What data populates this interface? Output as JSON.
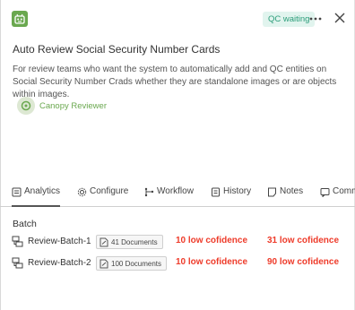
{
  "header": {
    "logo_icon": "robot-icon",
    "status": "QC waiting",
    "more_icon": "more-horizontal-icon",
    "close_icon": "close-icon"
  },
  "project": {
    "title": "Auto Review Social Security Number Cards",
    "description": "For review teams who want the system to automatically add and QC entities on Social Security Number Crads whether they are standalone images or are objects within images.",
    "creator": "Canopy Reviewer"
  },
  "tabs": [
    {
      "label": "Analytics",
      "icon": "analytics-icon",
      "active": true
    },
    {
      "label": "Configure",
      "icon": "gear-icon",
      "active": false
    },
    {
      "label": "Workflow",
      "icon": "workflow-icon",
      "active": false
    },
    {
      "label": "History",
      "icon": "history-icon",
      "active": false
    },
    {
      "label": "Notes",
      "icon": "notes-icon",
      "active": false
    },
    {
      "label": "Comm",
      "icon": "comments-icon",
      "active": false
    }
  ],
  "batch": {
    "section_label": "Batch",
    "rows": [
      {
        "name": "Review-Batch-1",
        "documents": "41 Documents",
        "low_conf_1": "10 low cofidence",
        "low_conf_2": "31 low cofidence"
      },
      {
        "name": "Review-Batch-2",
        "documents": "100 Documents",
        "low_conf_1": "10 low cofidence",
        "low_conf_2": "90 low cofidence"
      }
    ]
  },
  "colors": {
    "accent_green": "#6aa84f",
    "status_teal": "#2c9d7a",
    "alert_red": "#ee3b2a"
  }
}
